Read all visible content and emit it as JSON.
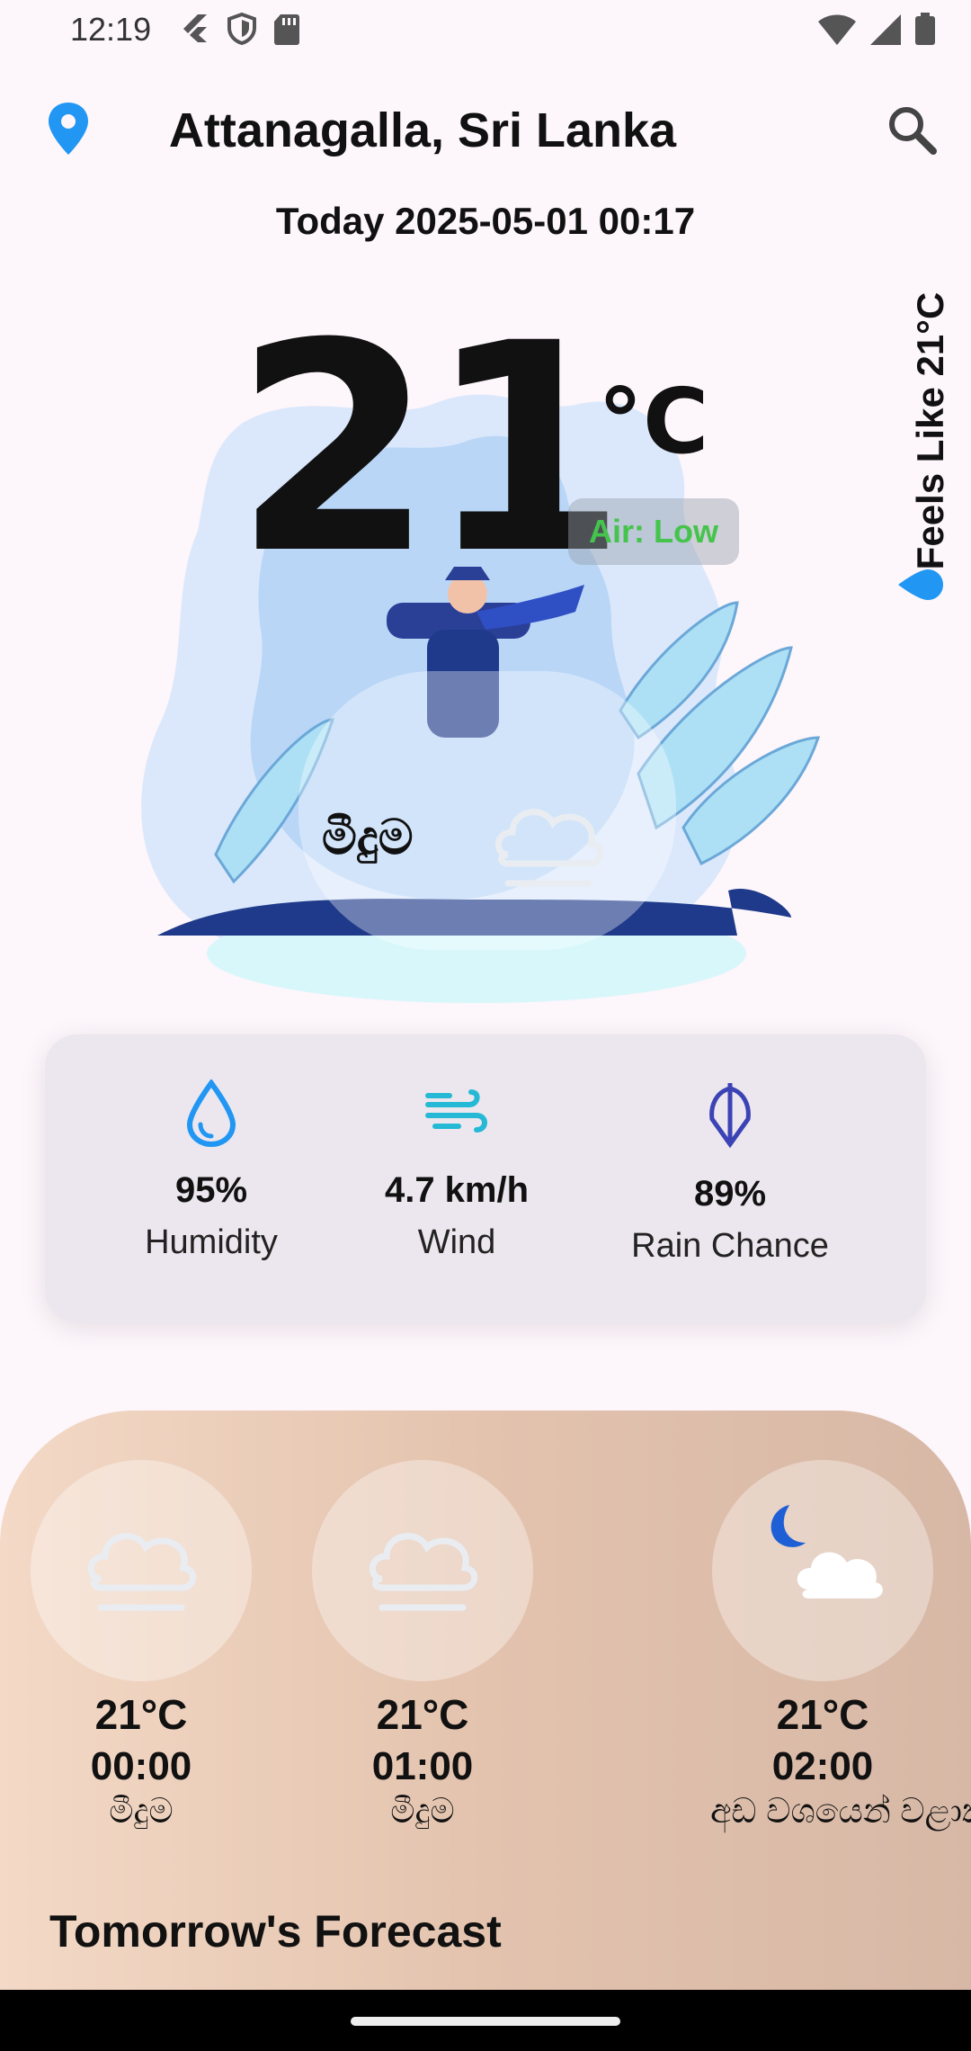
{
  "status_bar": {
    "time": "12:19"
  },
  "header": {
    "location": "Attanagalla, Sri Lanka"
  },
  "date_line": "Today 2025-05-01 00:17",
  "current": {
    "temp": "21",
    "unit": "°C",
    "air": "Air: Low",
    "condition": "මීදුම",
    "feels_like": "Feels Like 21°C"
  },
  "stats": [
    {
      "icon": "humidity-drop-icon",
      "value": "95%",
      "label": "Humidity"
    },
    {
      "icon": "wind-icon",
      "value": "4.7 km/h",
      "label": "Wind"
    },
    {
      "icon": "umbrella-icon",
      "value": "89%",
      "label": "Rain Chance"
    }
  ],
  "hourly": [
    {
      "temp": "21°C",
      "time": "00:00",
      "desc": "මීදුම",
      "icon": "fog-cloud-icon"
    },
    {
      "temp": "21°C",
      "time": "01:00",
      "desc": "මීදුම",
      "icon": "fog-cloud-icon"
    },
    {
      "temp": "21°C",
      "time": "02:00",
      "desc": "අඩ වශයෙන් වළාකුළු ස",
      "icon": "moon-cloud-icon"
    }
  ],
  "section_title": "Tomorrow's Forecast",
  "colors": {
    "accent_blue": "#2196f3",
    "air_green": "#45c44d",
    "wind_teal": "#25b9d6",
    "umbrella_indigo": "#3b43b5"
  }
}
